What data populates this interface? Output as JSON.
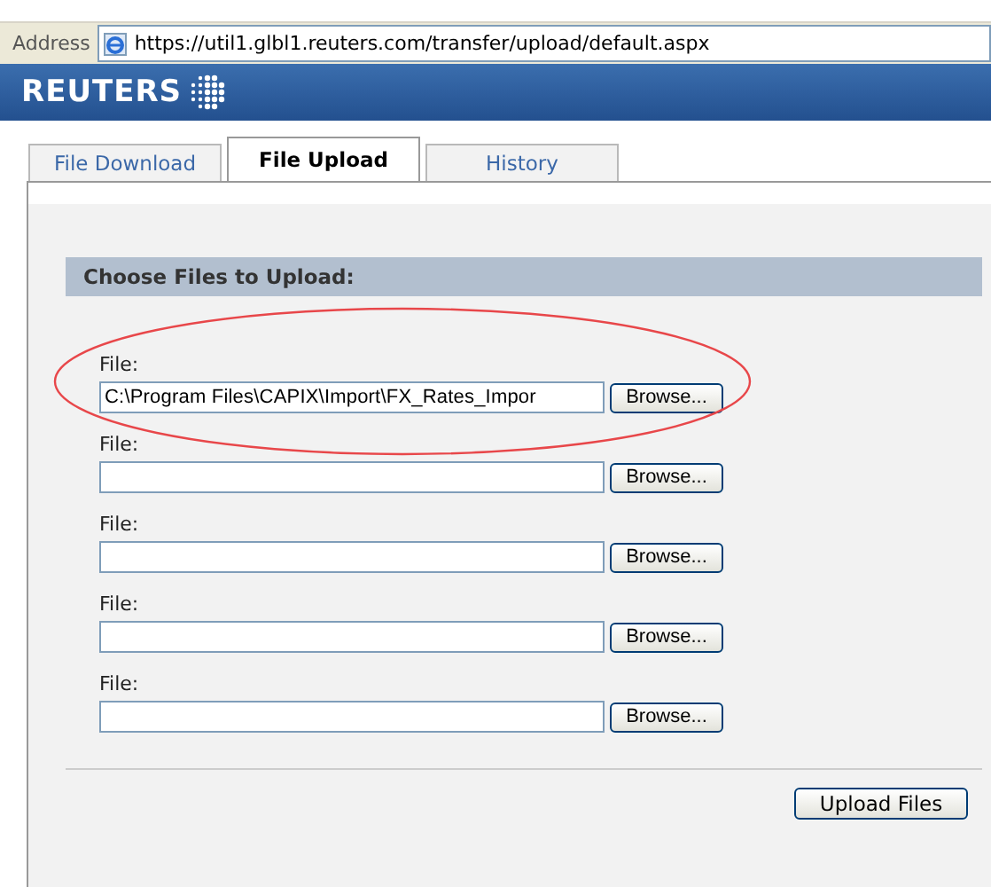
{
  "address_bar": {
    "label": "Address",
    "url": "https://util1.glbl1.reuters.com/transfer/upload/default.aspx"
  },
  "banner": {
    "logo": "REUTERS"
  },
  "tabs": [
    {
      "label": "File Download",
      "selected": false
    },
    {
      "label": "File Upload",
      "selected": true
    },
    {
      "label": "History",
      "selected": false
    }
  ],
  "section": {
    "title": "Choose Files to Upload:"
  },
  "file_rows": [
    {
      "label": "File:",
      "value": "C:\\Program Files\\CAPIX\\Import\\FX_Rates_Impor",
      "button": "Browse...",
      "highlighted": true
    },
    {
      "label": "File:",
      "value": "",
      "button": "Browse...",
      "highlighted": false
    },
    {
      "label": "File:",
      "value": "",
      "button": "Browse...",
      "highlighted": false
    },
    {
      "label": "File:",
      "value": "",
      "button": "Browse...",
      "highlighted": false
    },
    {
      "label": "File:",
      "value": "",
      "button": "Browse...",
      "highlighted": false
    }
  ],
  "submit_button": "Upload Files"
}
